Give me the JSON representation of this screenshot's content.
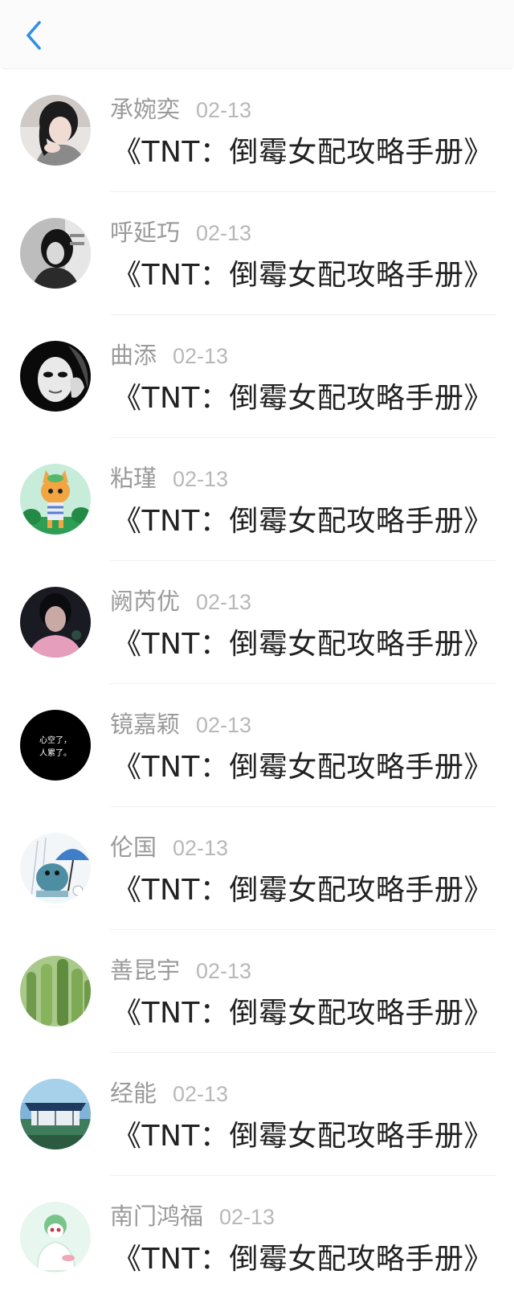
{
  "header": {
    "back_icon": "chevron-left-icon",
    "accent_color": "#2f8fe6"
  },
  "comments": [
    {
      "name": "承婉奕",
      "date": "02-13",
      "text": "《TNT：倒霉女配攻略手册》",
      "avatar": "girl-portrait-avatar"
    },
    {
      "name": "呼延巧",
      "date": "02-13",
      "text": "《TNT：倒霉女配攻略手册》",
      "avatar": "bw-girl-avatar"
    },
    {
      "name": "曲添",
      "date": "02-13",
      "text": "《TNT：倒霉女配攻略手册》",
      "avatar": "mask-avatar"
    },
    {
      "name": "粘瑾",
      "date": "02-13",
      "text": "《TNT：倒霉女配攻略手册》",
      "avatar": "cartoon-cat-avatar"
    },
    {
      "name": "阙芮优",
      "date": "02-13",
      "text": "《TNT：倒霉女配攻略手册》",
      "avatar": "dark-girl-avatar"
    },
    {
      "name": "镜嘉颖",
      "date": "02-13",
      "text": "《TNT：倒霉女配攻略手册》",
      "avatar": "black-text-avatar",
      "avatar_text": [
        "心空了，",
        "人累了。"
      ]
    },
    {
      "name": "伦国",
      "date": "02-13",
      "text": "《TNT：倒霉女配攻略手册》",
      "avatar": "cartoon-umbrella-avatar"
    },
    {
      "name": "善昆宇",
      "date": "02-13",
      "text": "《TNT：倒霉女配攻略手册》",
      "avatar": "cactus-avatar"
    },
    {
      "name": "经能",
      "date": "02-13",
      "text": "《TNT：倒霉女配攻略手册》",
      "avatar": "anime-scene-avatar"
    },
    {
      "name": "南门鸿福",
      "date": "02-13",
      "text": "《TNT：倒霉女配攻略手册》",
      "avatar": "pokemon-avatar"
    }
  ]
}
